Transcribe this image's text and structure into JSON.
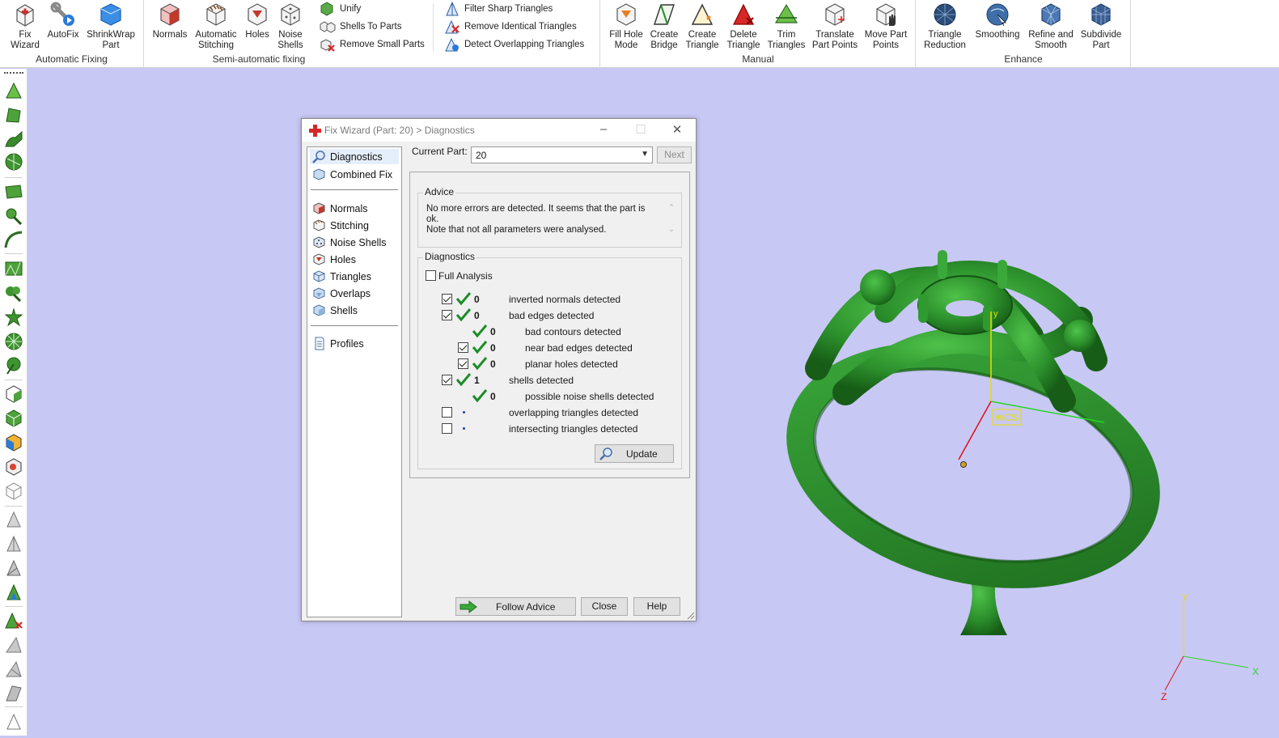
{
  "ribbon": {
    "groups": {
      "automatic_fixing": "Automatic Fixing",
      "semi_automatic_fixing": "Semi-automatic fixing",
      "manual": "Manual",
      "enhance": "Enhance"
    },
    "buttons": {
      "fix_wizard": "Fix\nWizard",
      "autofix": "AutoFix",
      "shrinkwrap": "ShrinkWrap\nPart",
      "normals": "Normals",
      "automatic_stitching": "Automatic\nStitching",
      "holes": "Holes",
      "noise_shells": "Noise\nShells",
      "unify": "Unify",
      "shells_to_parts": "Shells To Parts",
      "remove_small_parts": "Remove Small Parts",
      "filter_sharp": "Filter Sharp Triangles",
      "remove_identical": "Remove Identical Triangles",
      "detect_overlapping": "Detect Overlapping Triangles",
      "fill_hole_mode": "Fill Hole\nMode",
      "create_bridge": "Create\nBridge",
      "create_triangle": "Create\nTriangle",
      "delete_triangle": "Delete\nTriangle",
      "trim_triangles": "Trim\nTriangles",
      "translate_part_points": "Translate\nPart Points",
      "move_part_points": "Move Part\nPoints",
      "triangle_reduction": "Triangle\nReduction",
      "smoothing": "Smoothing",
      "refine_and_smooth": "Refine and\nSmooth",
      "subdivide_part": "Subdivide\nPart"
    }
  },
  "dialog": {
    "title": "Fix Wizard (Part: 20) > Diagnostics",
    "nav": {
      "diagnostics": "Diagnostics",
      "combined_fix": "Combined Fix",
      "normals": "Normals",
      "stitching": "Stitching",
      "noise_shells": "Noise Shells",
      "holes": "Holes",
      "triangles": "Triangles",
      "overlaps": "Overlaps",
      "shells": "Shells",
      "profiles": "Profiles"
    },
    "current_part_label": "Current Part:",
    "current_part_value": "20",
    "next_label": "Next",
    "advice_title": "Advice",
    "advice_line1": "No more errors are detected. It seems that the part is ok.",
    "advice_line2": "Note that not all parameters were analysed.",
    "diagnostics_title": "Diagnostics",
    "full_analysis_label": "Full Analysis",
    "rows": {
      "inverted_normals": {
        "count": "0",
        "label": "inverted normals detected"
      },
      "bad_edges": {
        "count": "0",
        "label": "bad edges detected"
      },
      "bad_contours": {
        "count": "0",
        "label": "bad contours detected"
      },
      "near_bad_edges": {
        "count": "0",
        "label": "near bad edges detected"
      },
      "planar_holes": {
        "count": "0",
        "label": "planar holes detected"
      },
      "shells": {
        "count": "1",
        "label": "shells detected"
      },
      "noise_shells": {
        "count": "0",
        "label": "possible noise shells detected"
      },
      "overlapping": {
        "label": "overlapping triangles detected"
      },
      "intersecting": {
        "label": "intersecting triangles detected"
      }
    },
    "update_label": "Update",
    "follow_advice_label": "Follow Advice",
    "close_label": "Close",
    "help_label": "Help"
  },
  "viewport": {
    "wcs_label": "WCS",
    "axis_y": "y",
    "corner_axis_x": "X",
    "corner_axis_y": "Y",
    "corner_axis_z": "Z",
    "background_color": "#c8c8f5",
    "model_color": "#2e8b2e"
  }
}
